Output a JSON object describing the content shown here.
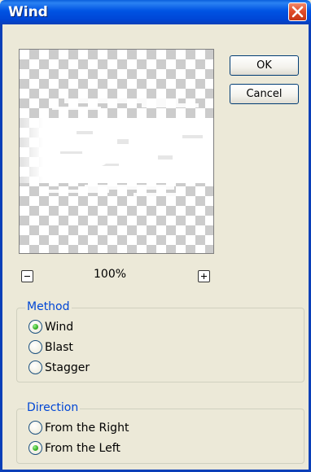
{
  "window": {
    "title": "Wind"
  },
  "buttons": {
    "ok_label": "OK",
    "cancel_label": "Cancel"
  },
  "zoom": {
    "level": "100%"
  },
  "method": {
    "label": "Method",
    "options": [
      {
        "label": "Wind",
        "selected": true
      },
      {
        "label": "Blast",
        "selected": false
      },
      {
        "label": "Stagger",
        "selected": false
      }
    ]
  },
  "direction": {
    "label": "Direction",
    "options": [
      {
        "label": "From the Right",
        "selected": false
      },
      {
        "label": "From the Left",
        "selected": true
      }
    ]
  },
  "icons": {
    "close": "close-icon",
    "zoom_out": "zoom-out-icon",
    "zoom_in": "zoom-in-icon",
    "radio_selected": "radio-selected-icon",
    "radio_empty": "radio-empty-icon"
  },
  "colors": {
    "title_bar": "#0053e3",
    "group_label": "#0046d5",
    "close": "#e24d2a",
    "radio_dot": "#3db62a"
  }
}
